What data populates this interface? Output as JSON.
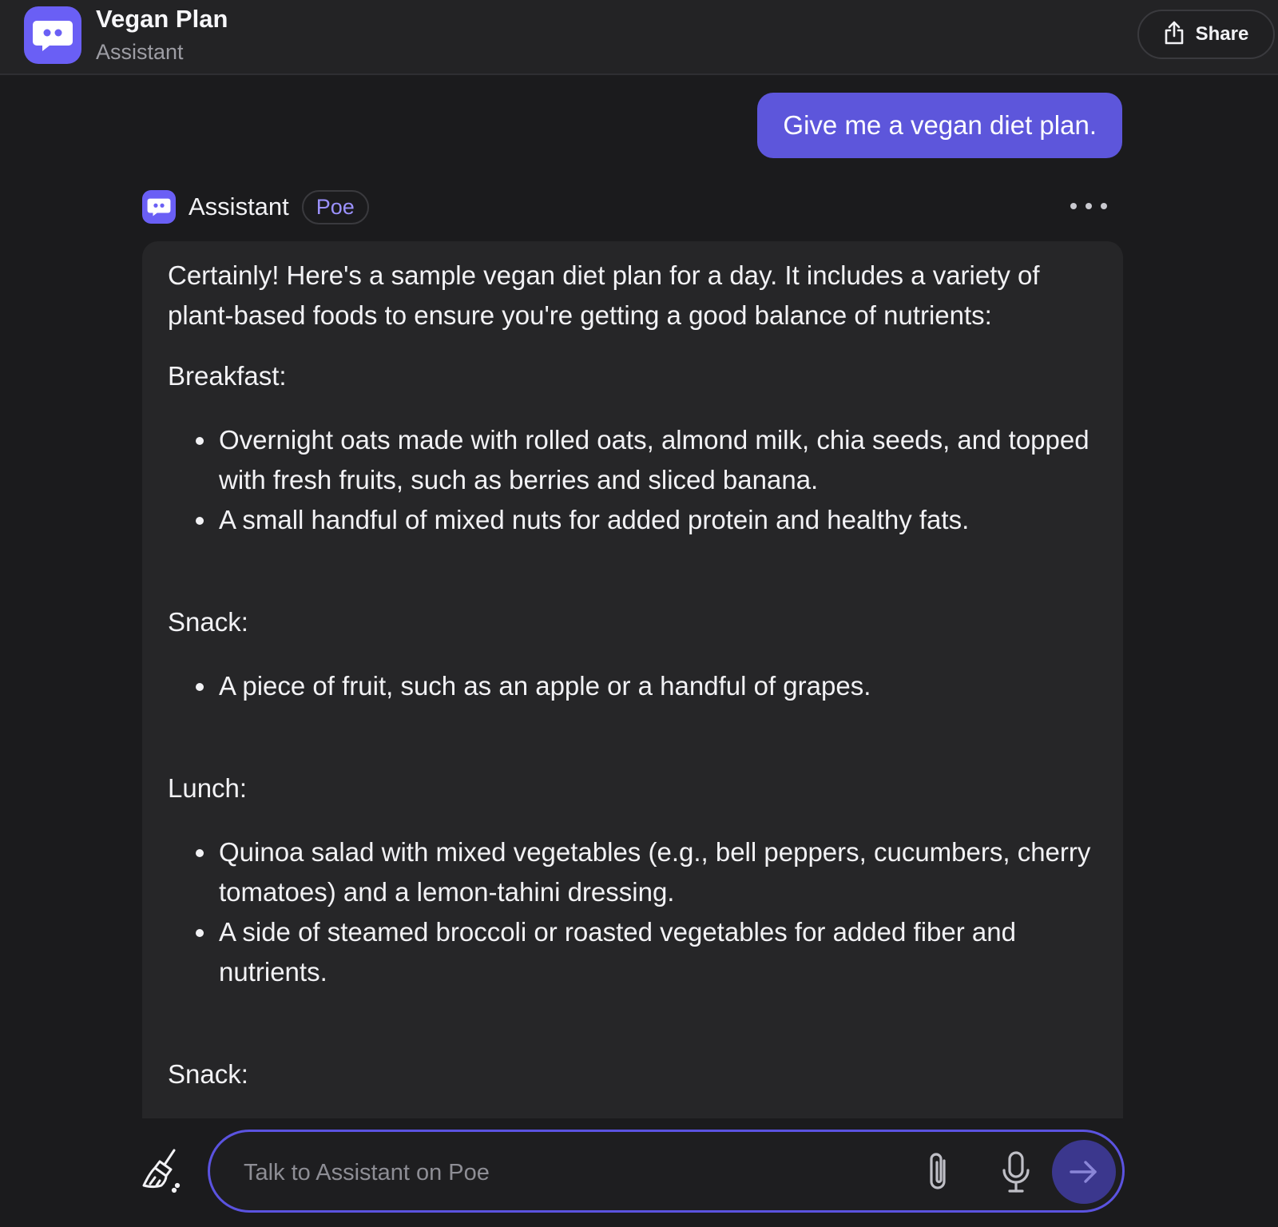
{
  "header": {
    "title": "Vegan Plan",
    "subtitle": "Assistant",
    "share_label": "Share"
  },
  "conversation": {
    "user_message": "Give me a vegan diet plan.",
    "bot": {
      "name": "Assistant",
      "badge": "Poe",
      "intro": "Certainly! Here's a sample vegan diet plan for a day. It includes a variety of plant-based foods to ensure you're getting a good balance of nutrients:",
      "sections": [
        {
          "heading": "Breakfast:",
          "items": [
            "Overnight oats made with rolled oats, almond milk, chia seeds, and topped with fresh fruits, such as berries and sliced banana.",
            "A small handful of mixed nuts for added protein and healthy fats."
          ]
        },
        {
          "heading": "Snack:",
          "items": [
            "A piece of fruit, such as an apple or a handful of grapes."
          ]
        },
        {
          "heading": "Lunch:",
          "items": [
            "Quinoa salad with mixed vegetables (e.g., bell peppers, cucumbers, cherry tomatoes) and a lemon-tahini dressing.",
            "A side of steamed broccoli or roasted vegetables for added fiber and nutrients."
          ]
        },
        {
          "heading": "Snack:",
          "items": []
        }
      ]
    }
  },
  "composer": {
    "placeholder": "Talk to Assistant on Poe"
  },
  "icons": {
    "bot_avatar": "robot-chat-icon",
    "share": "share-icon",
    "more": "more-dots-icon",
    "clear": "broom-icon",
    "attach": "paperclip-icon",
    "mic": "microphone-icon",
    "send": "arrow-right-icon"
  },
  "colors": {
    "accent": "#5d56db",
    "background": "#1b1b1d",
    "bubble": "#262628",
    "badge_text": "#9b91ff"
  }
}
